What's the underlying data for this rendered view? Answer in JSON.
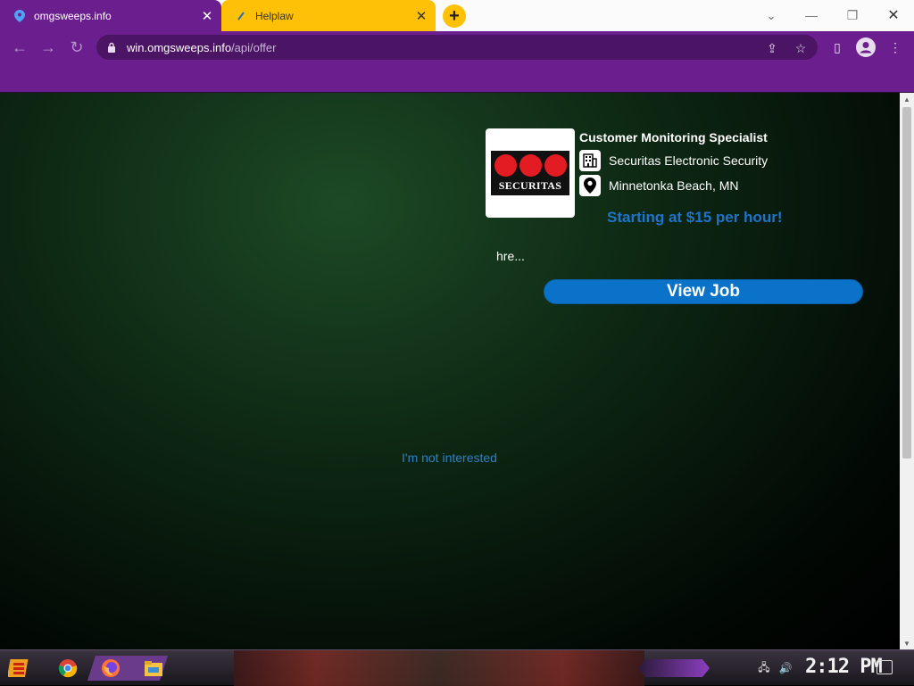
{
  "browser": {
    "tabs": [
      {
        "title": "omgsweeps.info",
        "active": true
      },
      {
        "title": "Helplaw",
        "active": false
      }
    ],
    "url_host": "win.omgsweeps.info",
    "url_path": "/api/offer",
    "theme_color": "#6b1f8e",
    "second_tab_color": "#ffc107"
  },
  "job": {
    "title": "Customer Monitoring Specialist",
    "company": "Securitas Electronic Security",
    "location": "Minnetonka Beach, MN",
    "pay": "Starting at $15 per hour!",
    "snippet": "hre...",
    "logo_text": "SECURITAS",
    "view_button": "View Job",
    "decline_link": "I'm not interested",
    "button_color": "#0a72c8"
  },
  "taskbar": {
    "clock": "2:12 PM"
  }
}
